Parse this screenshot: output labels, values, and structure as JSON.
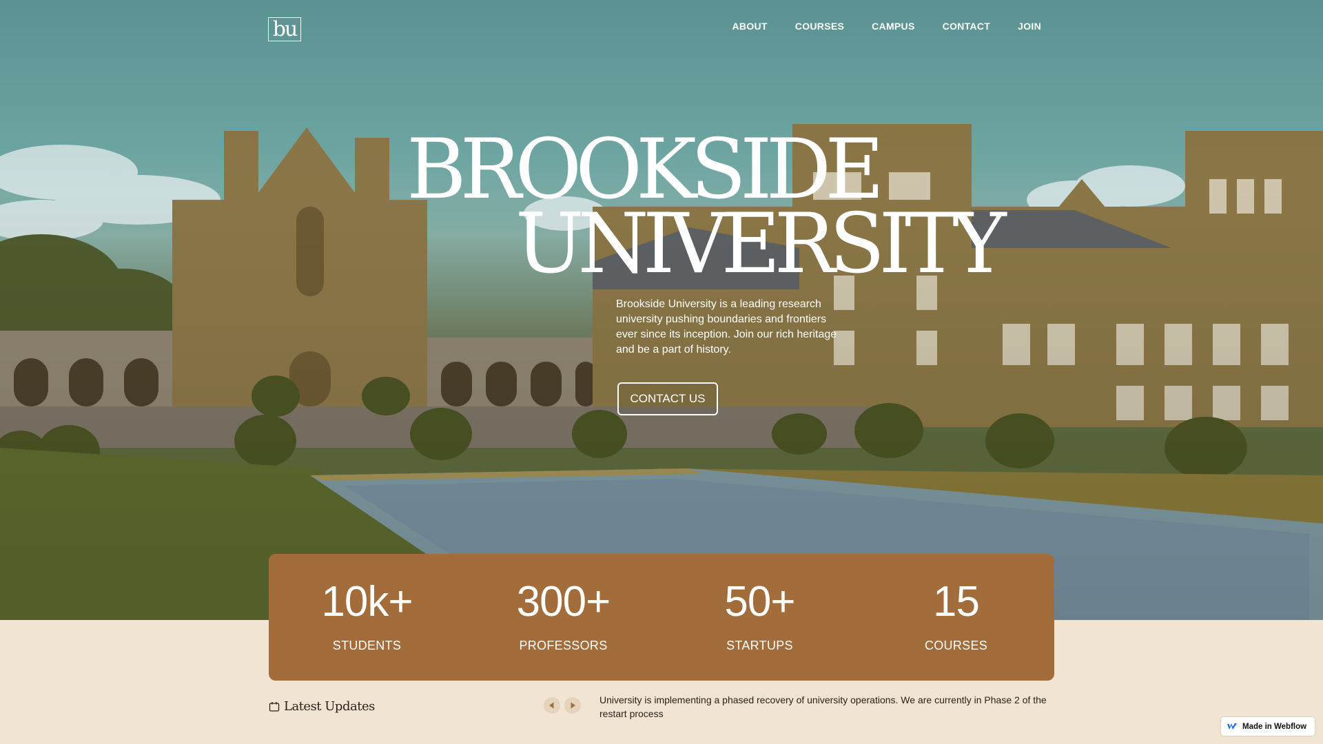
{
  "brand": {
    "logo_text": "bu"
  },
  "nav": {
    "items": [
      {
        "label": "ABOUT"
      },
      {
        "label": "COURSES"
      },
      {
        "label": "CAMPUS"
      },
      {
        "label": "CONTACT"
      },
      {
        "label": "JOIN"
      }
    ]
  },
  "hero": {
    "title_line1": "BROOKSIDE",
    "title_line2": "UNIVERSITY",
    "intro": "Brookside University is a leading research university pushing boundaries and frontiers ever since its inception. Join our rich heritage and be a part of history.",
    "cta_label": "CONTACT US",
    "image_description_icon": "campus-photo"
  },
  "stats": [
    {
      "value": "10k+",
      "label": "STUDENTS"
    },
    {
      "value": "300+",
      "label": "PROFESSORS"
    },
    {
      "value": "50+",
      "label": "STARTUPS"
    },
    {
      "value": "15",
      "label": "COURSES"
    }
  ],
  "updates": {
    "title": "Latest Updates",
    "text": "University is implementing a phased recovery of university operations. We are currently in Phase 2 of the restart process"
  },
  "badge": {
    "label": "Made in Webflow"
  },
  "colors": {
    "accent": "#a26d3a",
    "page_background": "#f1e4d2",
    "text_dark": "#2a211a"
  }
}
